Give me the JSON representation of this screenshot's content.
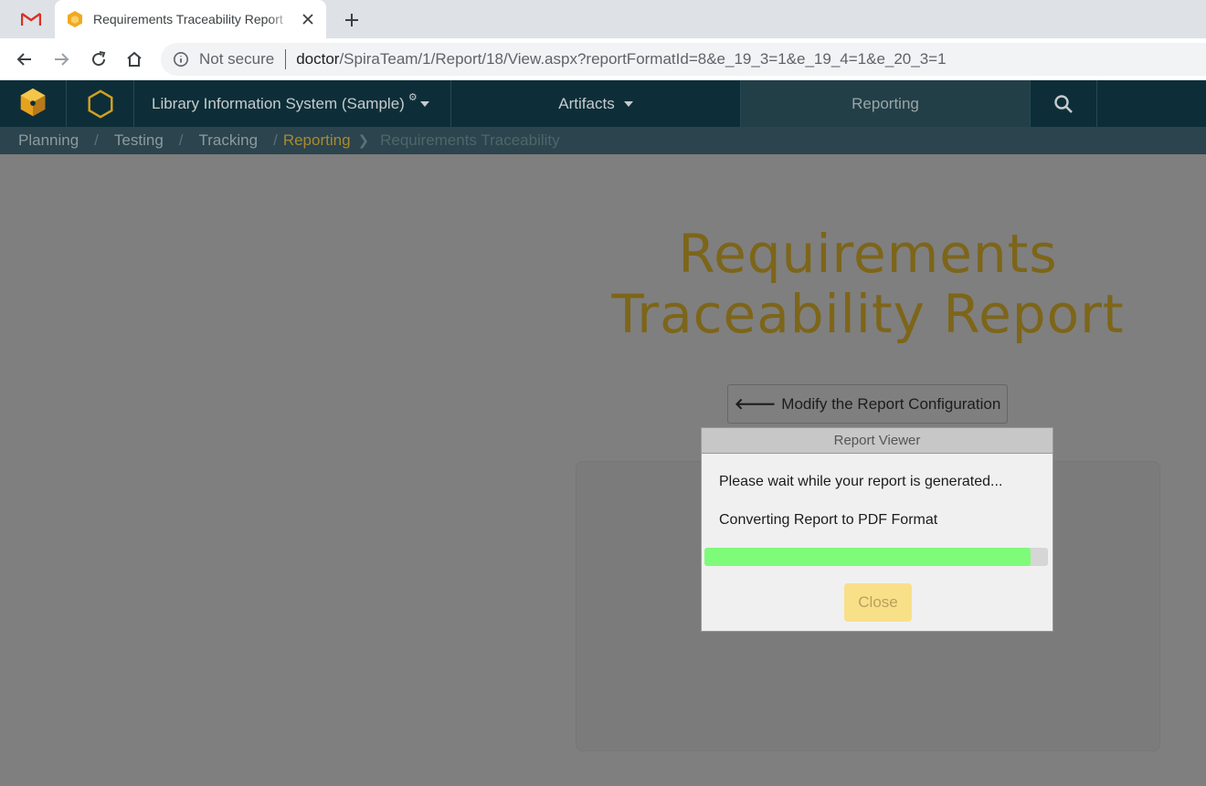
{
  "browser": {
    "tab_title": "Requirements Traceability Report",
    "address": {
      "security_label": "Not secure",
      "host": "doctor",
      "path": "/SpiraTeam/1/Report/18/View.aspx?reportFormatId=8&e_19_3=1&e_19_4=1&e_20_3=1"
    }
  },
  "app": {
    "project_name": "Library Information System (Sample)",
    "nav_artifacts": "Artifacts",
    "nav_reporting": "Reporting"
  },
  "breadcrumb": {
    "planning": "Planning",
    "testing": "Testing",
    "tracking": "Tracking",
    "reporting": "Reporting",
    "current": "Requirements Traceability"
  },
  "page": {
    "title_line1": "Requirements",
    "title_line2": "Traceability Report",
    "modify_label": "Modify the Report Configuration"
  },
  "modal": {
    "title": "Report Viewer",
    "message": "Please wait while your report is generated...",
    "status": "Converting Report to PDF Format",
    "progress_percent": 95,
    "close_label": "Close"
  },
  "colors": {
    "header_bg": "#0d2e38",
    "accent_gold": "#7d6519",
    "progress_fill": "#7ffb7a"
  }
}
